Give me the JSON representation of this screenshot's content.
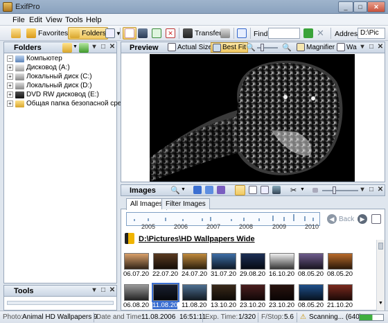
{
  "window": {
    "title": "ExifPro",
    "minimize": "_",
    "maximize": "□",
    "close": "✕"
  },
  "menu": [
    "File",
    "Edit",
    "View",
    "Tools",
    "Help"
  ],
  "toolbar": {
    "favorites": "Favorites",
    "folders": "Folders",
    "transfer": "Transfer",
    "find_label": "Find",
    "find_value": "",
    "address_label": "Address",
    "address_value": "D:\\Pic"
  },
  "folders_panel": {
    "title": "Folders",
    "tree": [
      {
        "label": "Компьютер",
        "level": 0,
        "expander": "−"
      },
      {
        "label": "Дисковод (A:)",
        "level": 1,
        "expander": "+"
      },
      {
        "label": "Локальный диск (C:)",
        "level": 1,
        "expander": "+"
      },
      {
        "label": "Локальный диск (D:)",
        "level": 1,
        "expander": "+"
      },
      {
        "label": "DVD RW дисковод (E:)",
        "level": 1,
        "expander": "+"
      },
      {
        "label": "Общая папка безопасной среды",
        "level": 1,
        "expander": "+"
      }
    ]
  },
  "tools_panel": {
    "title": "Tools"
  },
  "preview_panel": {
    "title": "Preview",
    "actual_size": "Actual Size",
    "best_fit": "Best Fit",
    "magnifier": "Magnifier",
    "wa": "Wa"
  },
  "images_panel": {
    "title": "Images",
    "tabs": [
      "All Images",
      "Filter Images"
    ],
    "years": [
      "2005",
      "2006",
      "2007",
      "2008",
      "2009",
      "2010"
    ],
    "back": "Back",
    "path": "D:\\Pictures\\HD Wallpapers Wide",
    "thumbnails_row1": [
      "06.07.20",
      "22.07.20",
      "24.07.20",
      "31.07.20",
      "29.08.20",
      "16.10.20",
      "08.05.20",
      "08.05.20"
    ],
    "thumbnails_row2": [
      "06.08.20",
      "11.08.20",
      "11.08.20",
      "13.10.20",
      "23.10.20",
      "23.10.20",
      "08.05.20",
      "21.10.20"
    ],
    "selected_index": 1
  },
  "status": {
    "photo_label": "Photo:",
    "photo_value": "Animal HD Wallpapers 9",
    "datetime_label": "Date and Time:",
    "datetime_value": "11.08.2006",
    "time_value": "16:51:11",
    "exp_label": "Exp. Time:",
    "exp_value": "1/320",
    "fstop_label": "F/Stop:",
    "fstop_value": "5.6",
    "scanning": "Scanning... (640)"
  },
  "colors": {
    "accent": "#3a78c8",
    "selected": "#3b6fd1",
    "panel_header": "#cbd6e4"
  }
}
